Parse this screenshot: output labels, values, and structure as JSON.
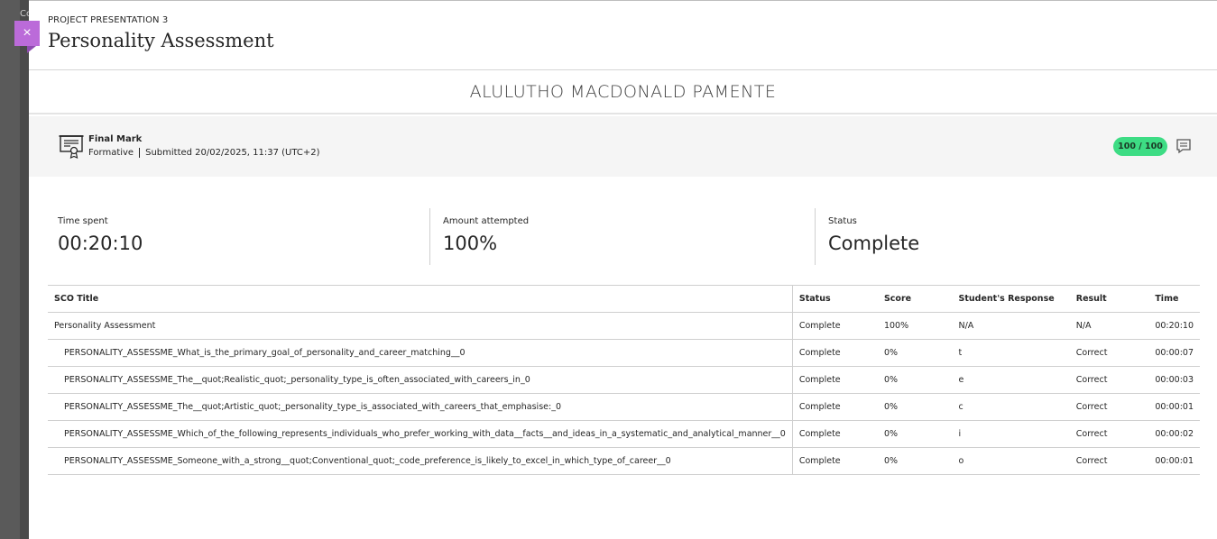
{
  "backdrop": {
    "text": "Co"
  },
  "header": {
    "eyebrow": "PROJECT PRESENTATION 3",
    "title": "Personality Assessment",
    "close_label": "×"
  },
  "student": {
    "name": "ALULUTHO MACDONALD PAMENTE"
  },
  "mark": {
    "label": "Final Mark",
    "type": "Formative",
    "submitted": "Submitted 20/02/2025, 11:37 (UTC+2)",
    "score": "100 / 100",
    "icon": "grading-certificate-icon",
    "feedback_icon": "comment-icon"
  },
  "stats": [
    {
      "label": "Time spent",
      "value": "00:20:10"
    },
    {
      "label": "Amount attempted",
      "value": "100%"
    },
    {
      "label": "Status",
      "value": "Complete"
    }
  ],
  "table": {
    "headers": [
      "SCO Title",
      "Status",
      "Score",
      "Student's Response",
      "Result",
      "Time"
    ],
    "rows": [
      [
        "Personality Assessment",
        "Complete",
        "100%",
        "N/A",
        "N/A",
        "00:20:10"
      ],
      [
        "PERSONALITY_ASSESSME_What_is_the_primary_goal_of_personality_and_career_matching__0",
        "Complete",
        "0%",
        "t",
        "Correct",
        "00:00:07"
      ],
      [
        "PERSONALITY_ASSESSME_The__quot;Realistic_quot;_personality_type_is_often_associated_with_careers_in_0",
        "Complete",
        "0%",
        "e",
        "Correct",
        "00:00:03"
      ],
      [
        "PERSONALITY_ASSESSME_The__quot;Artistic_quot;_personality_type_is_associated_with_careers_that_emphasise:_0",
        "Complete",
        "0%",
        "c",
        "Correct",
        "00:00:01"
      ],
      [
        "PERSONALITY_ASSESSME_Which_of_the_following_represents_individuals_who_prefer_working_with_data__facts__and_ideas_in_a_systematic_and_analytical_manner__0",
        "Complete",
        "0%",
        "i",
        "Correct",
        "00:00:02"
      ],
      [
        "PERSONALITY_ASSESSME_Someone_with_a_strong__quot;Conventional_quot;_code_preference_is_likely_to_excel_in_which_type_of_career__0",
        "Complete",
        "0%",
        "o",
        "Correct",
        "00:00:01"
      ]
    ]
  },
  "colors": {
    "close_button": "#bb6bd9",
    "score_pill": "#3ddc84",
    "mark_bar_bg": "#f5f5f5"
  }
}
